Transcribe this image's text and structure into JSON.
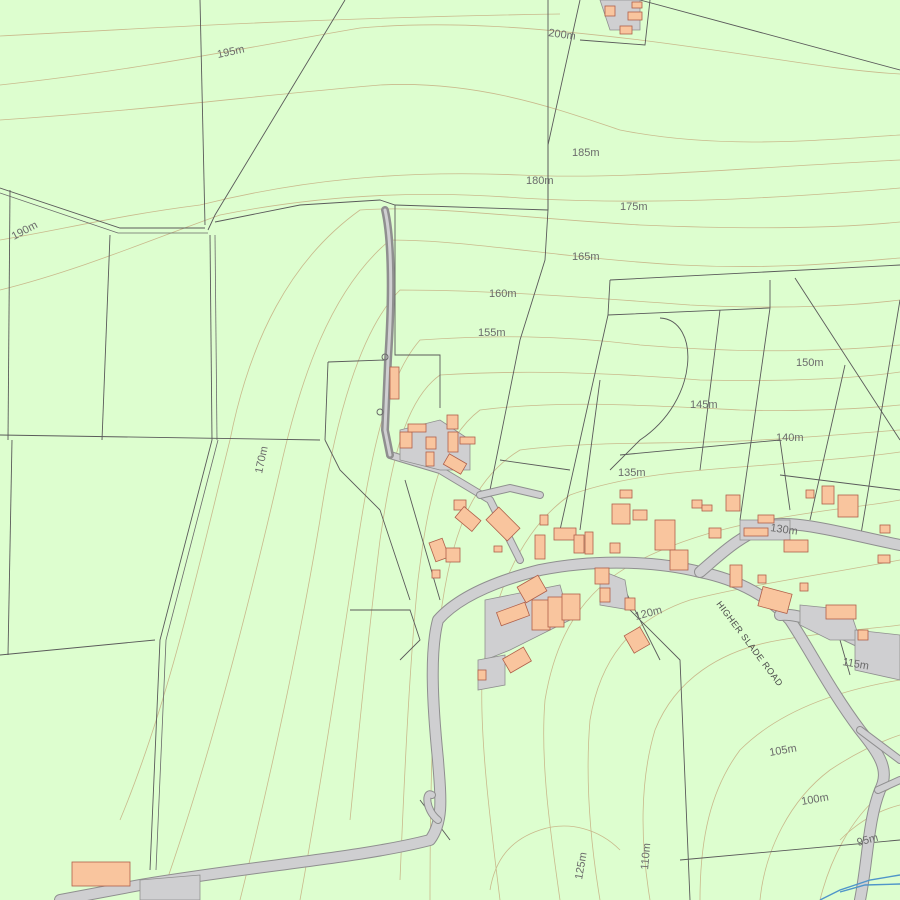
{
  "map": {
    "background_color": "#ddfecf",
    "contour_color": "#c9b98c",
    "boundary_color": "#5a5a5a",
    "road_color": "#cfcfd1",
    "building_color": "#f9c59e",
    "water_color": "#4f95c9"
  },
  "contour_labels": [
    "200m",
    "195m",
    "190m",
    "185m",
    "180m",
    "175m",
    "170m",
    "165m",
    "160m",
    "155m",
    "150m",
    "145m",
    "140m",
    "135m",
    "130m",
    "125m",
    "120m",
    "115m",
    "110m",
    "105m",
    "100m",
    "95m"
  ],
  "road_name": "HIGHER SLADE ROAD"
}
